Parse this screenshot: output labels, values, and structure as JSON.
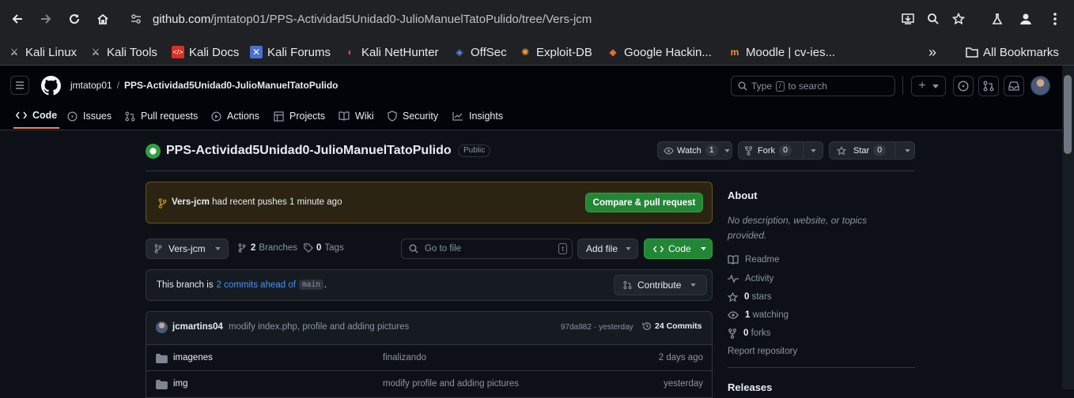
{
  "browser": {
    "url_host": "github.com",
    "url_path": "/jmtatop01/PPS-Actividad5Unidad0-JulioManuelTatoPulido/tree/Vers-jcm",
    "bookmarks": [
      {
        "label": "Kali Linux",
        "icon": "kali-icon"
      },
      {
        "label": "Kali Tools",
        "icon": "kali-icon"
      },
      {
        "label": "Kali Docs",
        "icon": "docs-icon"
      },
      {
        "label": "Kali Forums",
        "icon": "forums-icon"
      },
      {
        "label": "Kali NetHunter",
        "icon": "nethunter-icon"
      },
      {
        "label": "OffSec",
        "icon": "offsec-icon"
      },
      {
        "label": "Exploit-DB",
        "icon": "exploitdb-icon"
      },
      {
        "label": "Google Hackin...",
        "icon": "ghdb-icon"
      },
      {
        "label": "Moodle | cv-ies...",
        "icon": "moodle-icon"
      }
    ],
    "overflow": "»",
    "all_bookmarks": "All Bookmarks"
  },
  "header": {
    "owner": "jmtatop01",
    "separator": "/",
    "repo": "PPS-Actividad5Unidad0-JulioManuelTatoPulido",
    "search_type": "Type",
    "search_key": "/",
    "search_rest": "to search",
    "plus": "+"
  },
  "tabs": [
    "Code",
    "Issues",
    "Pull requests",
    "Actions",
    "Projects",
    "Wiki",
    "Security",
    "Insights"
  ],
  "repo": {
    "title": "PPS-Actividad5Unidad0-JulioManuelTatoPulido",
    "visibility": "Public",
    "watch_label": "Watch",
    "watch_count": "1",
    "fork_label": "Fork",
    "fork_count": "0",
    "star_label": "Star",
    "star_count": "0"
  },
  "push_banner": {
    "branch": "Vers-jcm",
    "text": "had recent pushes 1 minute ago",
    "button": "Compare & pull request"
  },
  "toolbar": {
    "branch": "Vers-jcm",
    "branches_count": "2",
    "branches_label": "Branches",
    "tags_count": "0",
    "tags_label": "Tags",
    "goto_placeholder": "Go to file",
    "goto_key": "t",
    "add_file": "Add file",
    "code": "Code"
  },
  "ahead": {
    "prefix": "This branch is",
    "link": "2 commits ahead of",
    "base": "main",
    "suffix": ".",
    "contribute": "Contribute"
  },
  "commit": {
    "author": "jcmartins04",
    "message": "modify index.php, profile and adding pictures",
    "hash": "97da982",
    "dot": "·",
    "when": "yesterday",
    "commits": "24 Commits"
  },
  "files": [
    {
      "name": "imagenes",
      "message": "finalizando",
      "age": "2 days ago"
    },
    {
      "name": "img",
      "message": "modify profile and adding pictures",
      "age": "yesterday"
    }
  ],
  "about": {
    "title": "About",
    "description": "No description, website, or topics provided.",
    "readme": "Readme",
    "activity": "Activity",
    "stars_count": "0",
    "stars_label": "stars",
    "watching_count": "1",
    "watching_label": "watching",
    "forks_count": "0",
    "forks_label": "forks",
    "report": "Report repository",
    "releases": "Releases"
  },
  "colors": {
    "accent_green": "#238636",
    "link_blue": "#4493f8",
    "banner_bg": "#2b2412",
    "tab_underline": "#f78166"
  }
}
